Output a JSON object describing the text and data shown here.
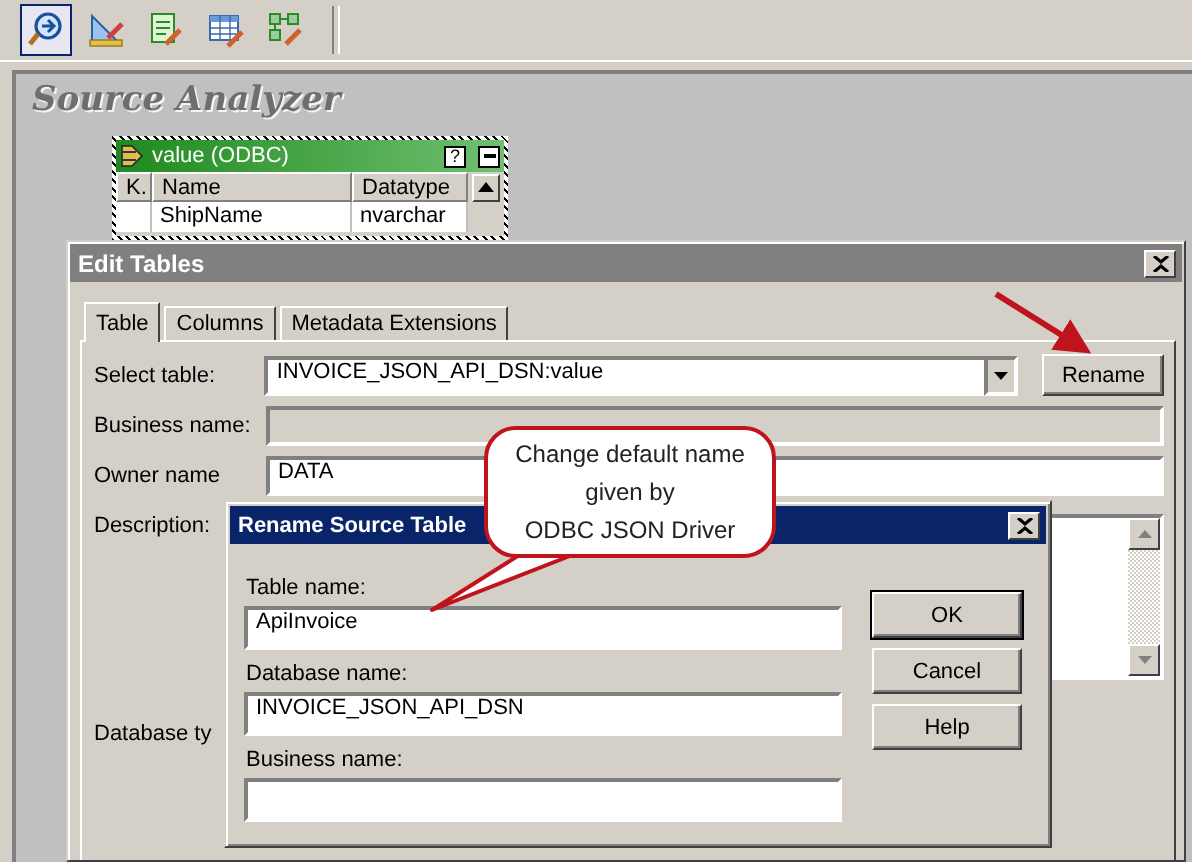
{
  "toolbar": {
    "tools": [
      {
        "kind": "analyzer",
        "selected": true
      },
      {
        "kind": "designer",
        "selected": false
      },
      {
        "kind": "list",
        "selected": false
      },
      {
        "kind": "grid",
        "selected": false
      },
      {
        "kind": "nodes",
        "selected": false
      }
    ]
  },
  "workspace": {
    "title": "Source Analyzer"
  },
  "source_table": {
    "title": "value (ODBC)",
    "help_button": "?",
    "columns": [
      "K.",
      "Name",
      "Datatype"
    ],
    "rows": [
      {
        "name": "ShipName",
        "datatype": "nvarchar"
      }
    ]
  },
  "edit_tables": {
    "title": "Edit Tables",
    "tabs": [
      {
        "label": "Table",
        "selected": true
      },
      {
        "label": "Columns",
        "selected": false
      },
      {
        "label": "Metadata Extensions",
        "selected": false
      }
    ],
    "fields": [
      {
        "kind": "combo",
        "label": "Select table:",
        "value": "INVOICE_JSON_API_DSN:value"
      },
      {
        "kind": "text",
        "label": "Business name:",
        "disabled": true
      },
      {
        "kind": "text",
        "label": "Owner name",
        "value": "DATA",
        "disabled": false
      },
      {
        "kind": "textarea",
        "label": "Description:"
      },
      {
        "kind": "label",
        "label": "Database ty"
      }
    ],
    "rename_button": "Rename"
  },
  "rename_dialog": {
    "title": "Rename Source Table",
    "fields": [
      {
        "label": "Table name:",
        "value": "ApiInvoice"
      },
      {
        "label": "Database name:",
        "value": "INVOICE_JSON_API_DSN"
      },
      {
        "label": "Business name:"
      }
    ],
    "buttons": [
      {
        "label": "OK",
        "default": true
      },
      {
        "label": "Cancel",
        "default": false
      },
      {
        "label": "Help",
        "default": false
      }
    ]
  },
  "callout": {
    "text": "Change default name\ngiven by\nODBC JSON Driver"
  }
}
